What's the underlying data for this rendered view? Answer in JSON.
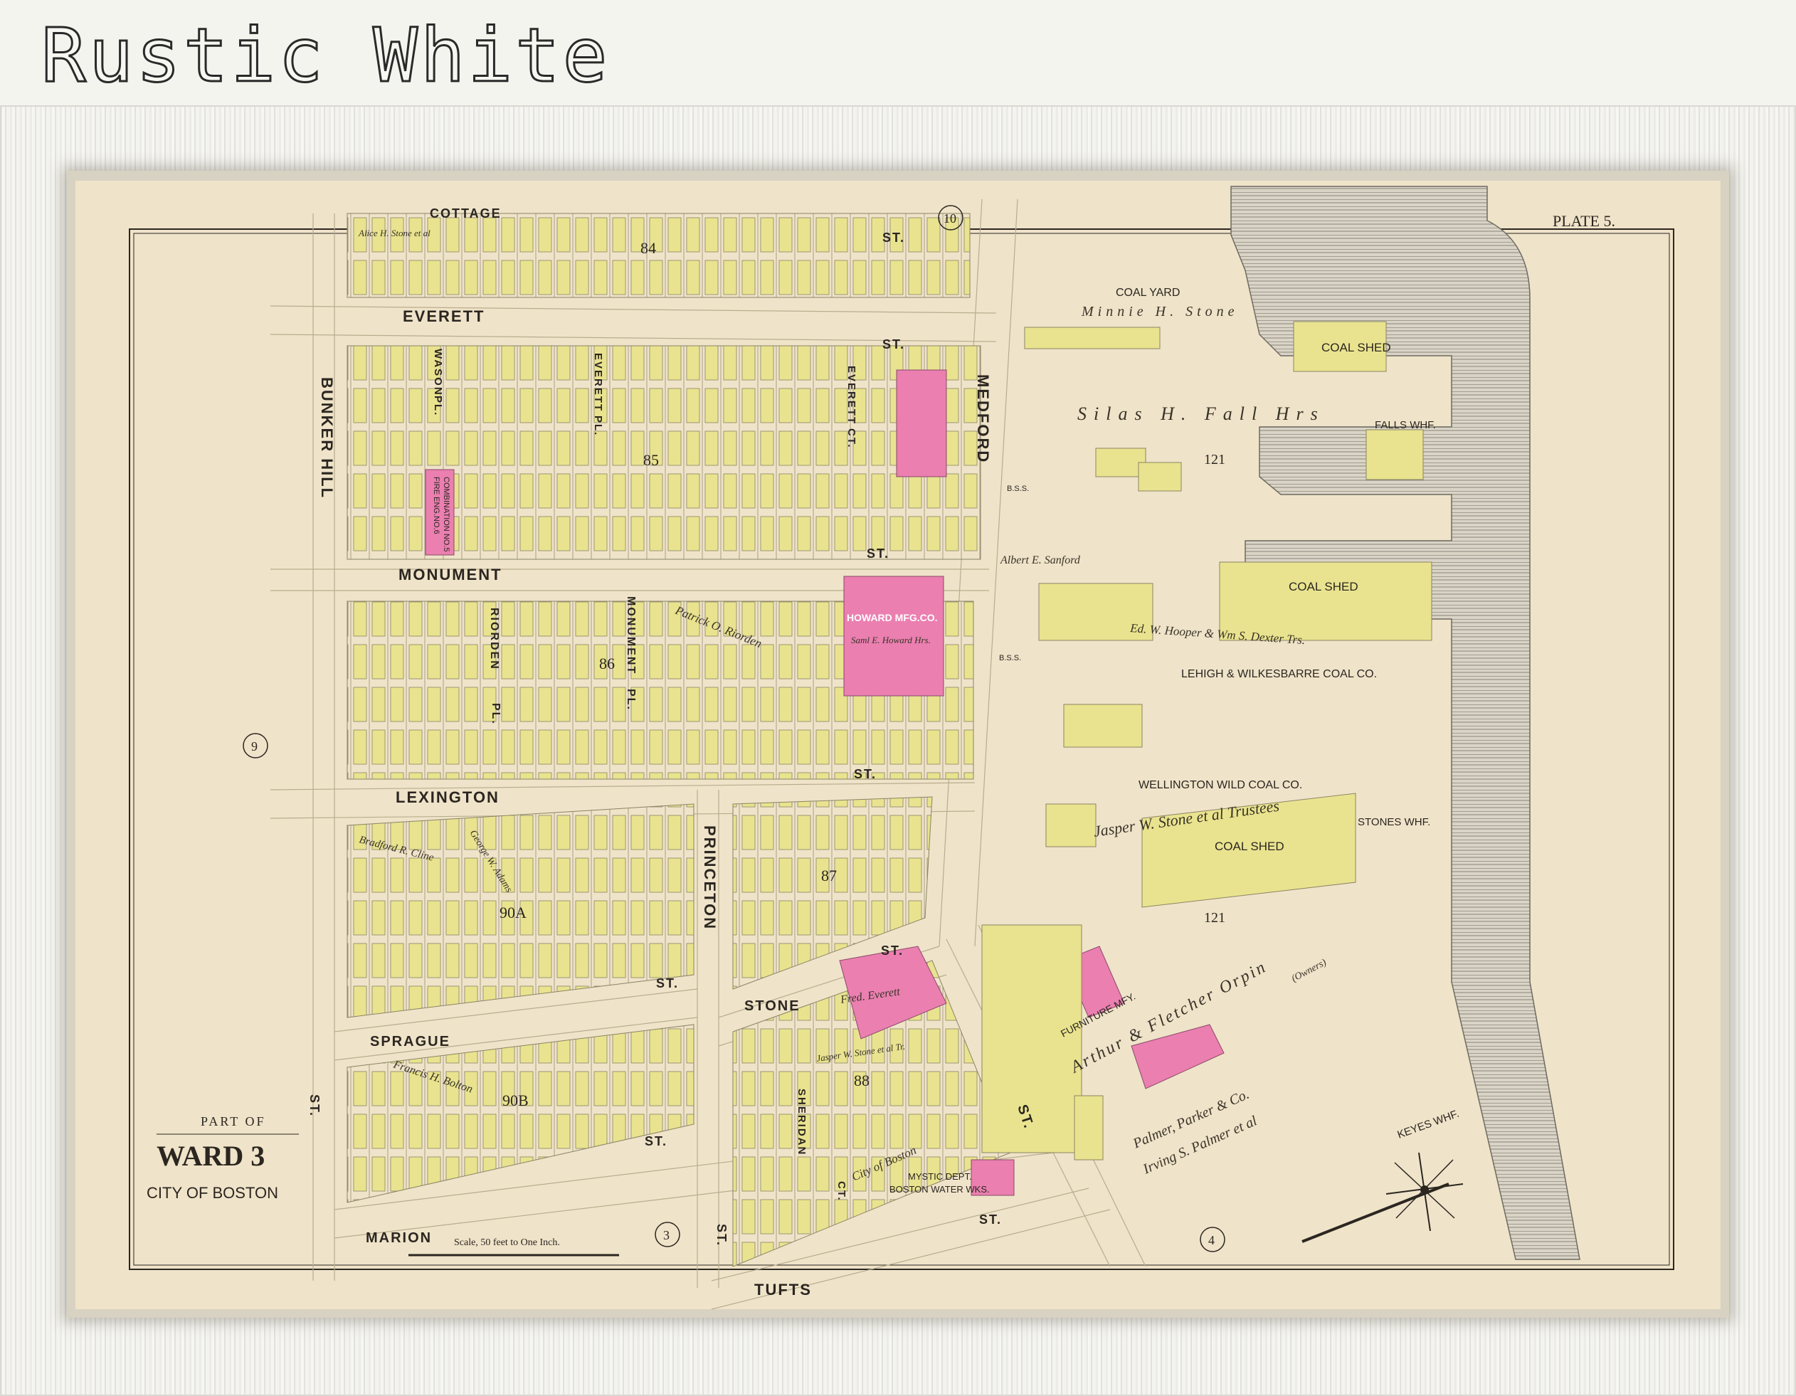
{
  "header": {
    "title": "Rustic White"
  },
  "map": {
    "plate": "PLATE 5.",
    "ward_part_of": "PART OF",
    "ward": "WARD 3",
    "city": "CITY OF BOSTON",
    "scale": "Scale, 50 feet to One Inch.",
    "plate_circles": [
      "10",
      "9",
      "3",
      "4"
    ],
    "blocks": [
      "84",
      "85",
      "86",
      "87",
      "88",
      "90A",
      "90B",
      "121",
      "121"
    ],
    "streets": {
      "cottage": "COTTAGE",
      "everett": "EVERETT",
      "monument": "MONUMENT",
      "lexington": "LEXINGTON",
      "sprague": "SPRAGUE",
      "marion": "MARION",
      "tufts": "TUFTS",
      "stone": "STONE",
      "princeton": "PRINCETON",
      "medford": "MEDFORD",
      "bunker_hill": "BUNKER HILL",
      "riorden": "RIORDEN",
      "everett_pl": "EVERETT",
      "wason": "WASON",
      "monument_pl": "MONUMENT",
      "sheridan": "SHERIDAN",
      "everett_ct": "EVERETT",
      "st": "ST.",
      "pl": "PL.",
      "ct": "CT."
    },
    "places": {
      "coal_yard": "COAL YARD",
      "coal_shed_1": "COAL SHED",
      "coal_shed_2": "COAL SHED",
      "coal_shed_3": "COAL SHED",
      "falls_whf": "FALLS WHF.",
      "stones_whf": "STONES WHF.",
      "keyes_whf": "KEYES WHF.",
      "lehigh": "LEHIGH & WILKESBARRE COAL CO.",
      "wellington": "WELLINGTON WILD COAL CO.",
      "howard_mfg": "HOWARD MFG.CO.",
      "furniture_mfy": "FURNITURE MFY.",
      "mystic_dept": "MYSTIC DEPT.",
      "boston_water": "BOSTON WATER WKS.",
      "fire_eng_1": "FIRE ENG.NO.6",
      "fire_eng_2": "COMBINATION NO.5",
      "bss_1": "B.S.S.",
      "bss_2": "B.S.S."
    },
    "owners": {
      "minnie": "Minnie H. Stone",
      "silas": "Silas H. Fall Hrs",
      "albert": "Albert E. Sanford",
      "hooper": "Ed. W. Hooper & Wm S. Dexter Trs.",
      "jasper": "Jasper W. Stone et al Trustees",
      "orpin": "Arthur & Fletcher Orpin",
      "owners_note": "(Owners)",
      "palmer": "Palmer, Parker & Co.",
      "irving": "Irving S. Palmer et al",
      "patrick": "Patrick O. Riorden",
      "samuel": "Saml E. Howard Hrs.",
      "fred": "Fred. Everett",
      "city": "City of Boston",
      "jasper_sm": "Jasper W. Stone et al Tr.",
      "francis": "Francis H. Bolton",
      "bradford": "Bradford R. Cline",
      "george": "George W. Adams",
      "alice": "Alice H. Stone et al"
    }
  }
}
